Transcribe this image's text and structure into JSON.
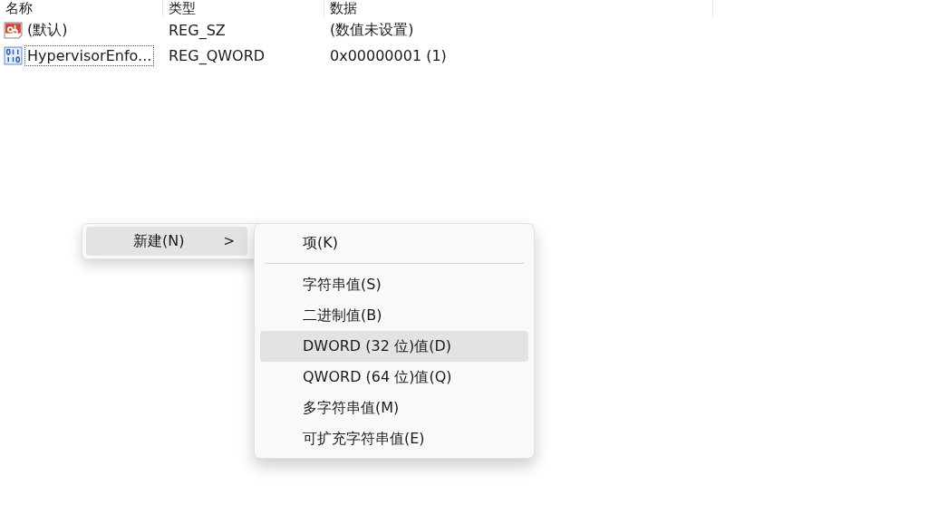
{
  "table": {
    "columns": [
      "名称",
      "类型",
      "数据"
    ],
    "rows": [
      {
        "kind": "string",
        "name": "(默认)",
        "type": "REG_SZ",
        "data": "(数值未设置)",
        "focused": false
      },
      {
        "kind": "binary",
        "name": "HypervisorEnfo...",
        "type": "REG_QWORD",
        "data": "0x00000001 (1)",
        "focused": true
      }
    ]
  },
  "context_menu": {
    "items": [
      {
        "label": "新建(N)",
        "submenu_arrow": ">",
        "selected": true
      }
    ]
  },
  "submenu": {
    "items": [
      {
        "kind": "item",
        "label": "项(K)",
        "selected": false
      },
      {
        "kind": "separator"
      },
      {
        "kind": "item",
        "label": "字符串值(S)",
        "selected": false
      },
      {
        "kind": "item",
        "label": "二进制值(B)",
        "selected": false
      },
      {
        "kind": "item",
        "label": "DWORD (32 位)值(D)",
        "selected": true
      },
      {
        "kind": "item",
        "label": "QWORD (64 位)值(Q)",
        "selected": false
      },
      {
        "kind": "item",
        "label": "多字符串值(M)",
        "selected": false
      },
      {
        "kind": "item",
        "label": "可扩充字符串值(E)",
        "selected": false
      }
    ]
  }
}
